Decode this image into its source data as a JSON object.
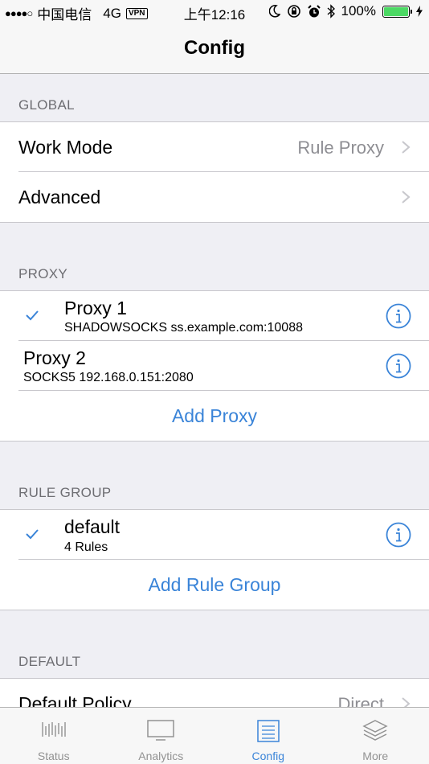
{
  "status_bar": {
    "signal": "●●●●○",
    "carrier": "中国电信",
    "network": "4G",
    "vpn": "VPN",
    "time": "上午12:16",
    "battery_percent": "100%"
  },
  "nav": {
    "title": "Config"
  },
  "global": {
    "header": "GLOBAL",
    "work_mode": {
      "label": "Work Mode",
      "value": "Rule Proxy"
    },
    "advanced": {
      "label": "Advanced"
    }
  },
  "proxy": {
    "header": "PROXY",
    "items": [
      {
        "name": "Proxy 1",
        "detail": "SHADOWSOCKS ss.example.com:10088",
        "selected": true
      },
      {
        "name": "Proxy 2",
        "detail": "SOCKS5 192.168.0.151:2080",
        "selected": false
      }
    ],
    "add_label": "Add Proxy"
  },
  "rule_group": {
    "header": "RULE GROUP",
    "items": [
      {
        "name": "default",
        "detail": "4 Rules",
        "selected": true
      }
    ],
    "add_label": "Add Rule Group"
  },
  "default": {
    "header": "DEFAULT",
    "policy": {
      "label": "Default Policy",
      "value": "Direct"
    }
  },
  "tabs": [
    {
      "label": "Status",
      "icon": "status-bars-icon",
      "active": false
    },
    {
      "label": "Analytics",
      "icon": "monitor-icon",
      "active": false
    },
    {
      "label": "Config",
      "icon": "document-list-icon",
      "active": true
    },
    {
      "label": "More",
      "icon": "layers-icon",
      "active": false
    }
  ],
  "colors": {
    "accent": "#3a84d8",
    "background": "#efeff4",
    "battery": "#4cd964"
  }
}
